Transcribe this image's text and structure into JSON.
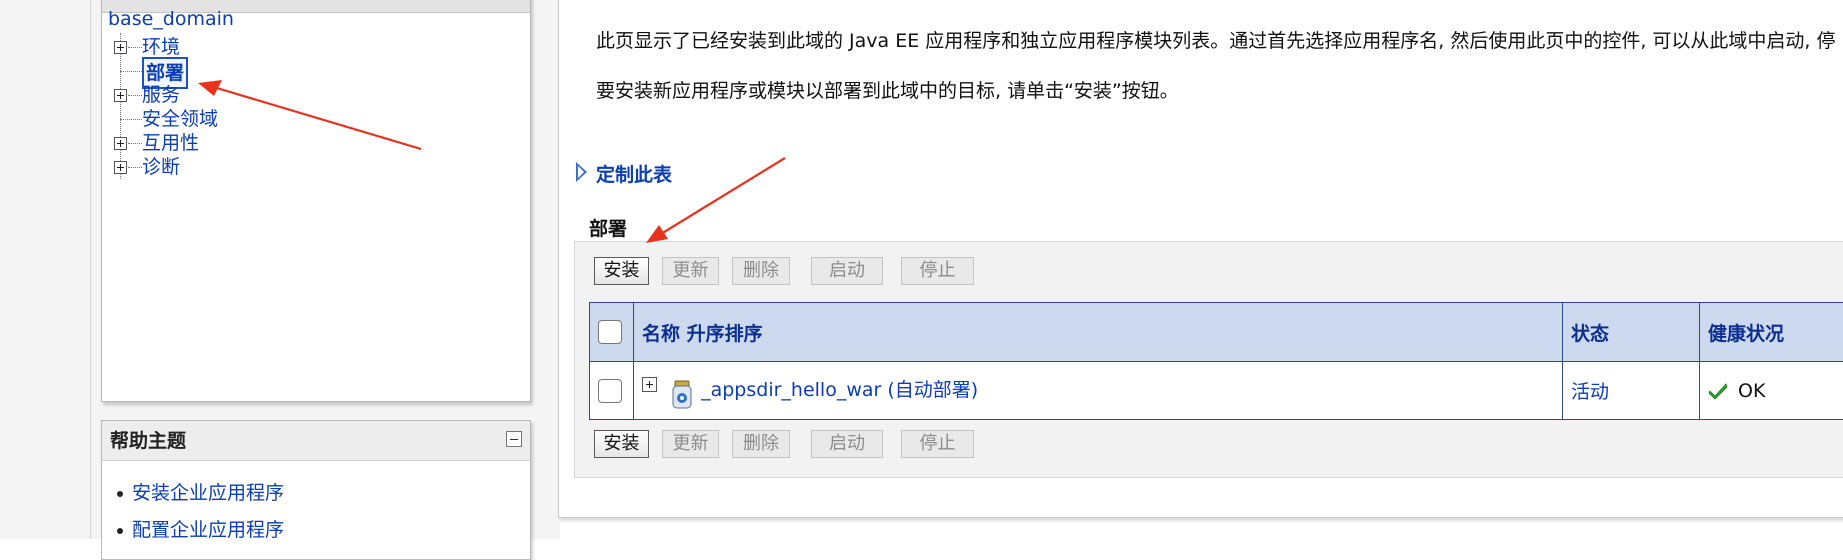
{
  "tree": {
    "root": "base_domain",
    "items": [
      {
        "label": "环境",
        "expandable": true
      },
      {
        "label": "部署",
        "expandable": false,
        "selected": true
      },
      {
        "label": "服务",
        "expandable": true
      },
      {
        "label": "安全领域",
        "expandable": false
      },
      {
        "label": "互用性",
        "expandable": true
      },
      {
        "label": "诊断",
        "expandable": true
      }
    ]
  },
  "help": {
    "title": "帮助主题",
    "links": [
      "安装企业应用程序",
      "配置企业应用程序"
    ]
  },
  "main": {
    "intro_line1": "此页显示了已经安装到此域的 Java EE 应用程序和独立应用程序模块列表。通过首先选择应用程序名, 然后使用此页中的控件, 可以从此域中启动, 停",
    "intro_line2": "要安装新应用程序或模块以部署到此域中的目标, 请单击“安装”按钮。",
    "customize": "定制此表",
    "section_title": "部署"
  },
  "buttons": {
    "install": "安装",
    "update": "更新",
    "delete": "删除",
    "start": "启动",
    "stop": "停止"
  },
  "table": {
    "headers": {
      "name": "名称 升序排序",
      "state": "状态",
      "health": "健康状况"
    },
    "rows": [
      {
        "name": "_appsdir_hello_war (自动部署)",
        "state": "活动",
        "health": "OK"
      }
    ]
  },
  "colors": {
    "link": "#0b3db5",
    "header_bg": "#ccd9ee",
    "annotation_arrow": "#e8321e"
  },
  "icons": {
    "tree_expand": "plus-box-icon",
    "panel_collapse": "minus-box-icon",
    "customize": "triangle-right-icon",
    "deployment": "jar-icon",
    "health_ok": "green-check-icon"
  }
}
